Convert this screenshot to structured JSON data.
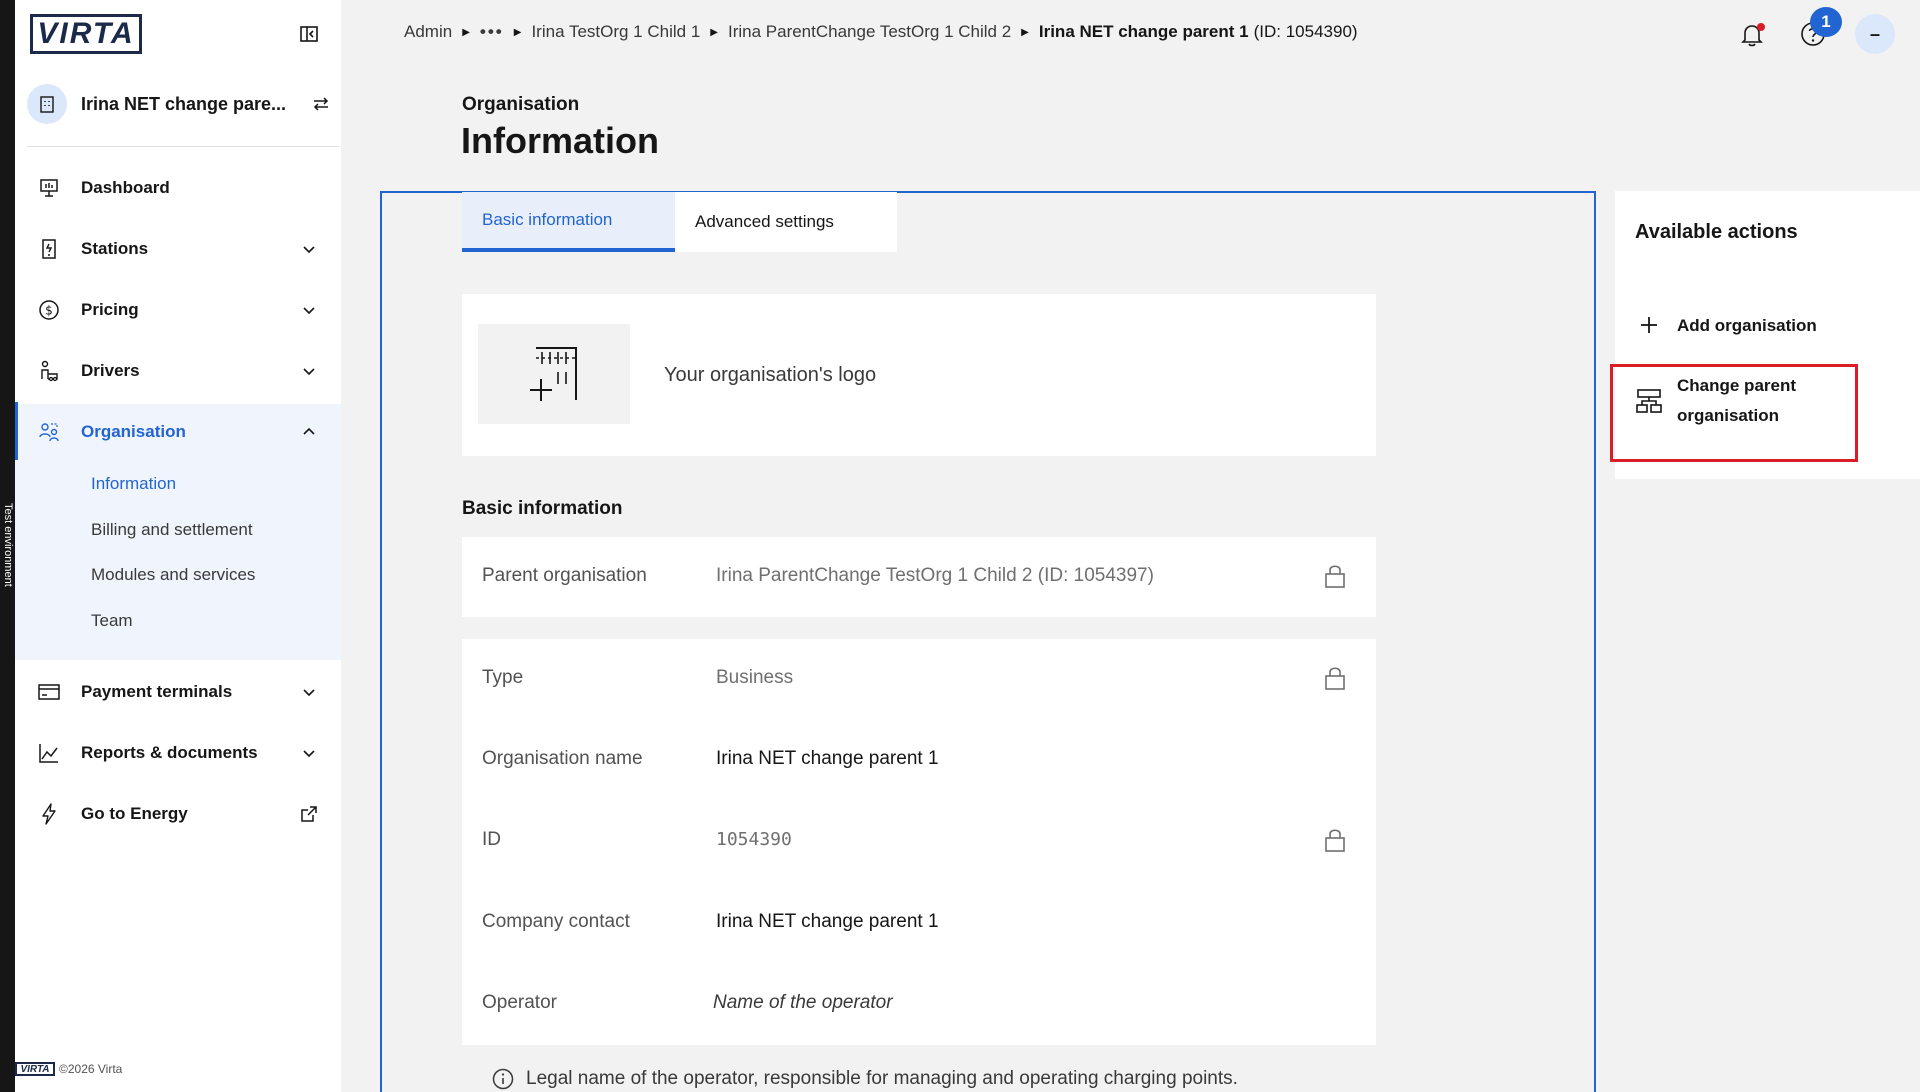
{
  "env": {
    "label": "Test environment"
  },
  "brand": {
    "logo_text": "VIRTA",
    "footer_logo": "VIRTA",
    "copyright": "©2026 Virta"
  },
  "org_switcher": {
    "name": "Irina NET change pare..."
  },
  "nav": {
    "dashboard": "Dashboard",
    "stations": "Stations",
    "pricing": "Pricing",
    "drivers": "Drivers",
    "organisation": "Organisation",
    "organisation_sub": [
      "Information",
      "Billing and settlement",
      "Modules and services",
      "Team"
    ],
    "payment_terminals": "Payment terminals",
    "reports": "Reports & documents",
    "energy": "Go to Energy"
  },
  "breadcrumb": {
    "items": [
      "Admin",
      "•••",
      "Irina TestOrg 1 Child 1",
      "Irina ParentChange TestOrg 1 Child 2"
    ],
    "current": "Irina NET change parent 1",
    "current_id": "(ID: 1054390)"
  },
  "topbar": {
    "help_badge": "1",
    "user_initial": "–"
  },
  "header": {
    "eyebrow": "Organisation",
    "title": "Information"
  },
  "tabs": [
    "Basic information",
    "Advanced settings"
  ],
  "logo_card": {
    "text": "Your organisation's logo"
  },
  "basic": {
    "section_title": "Basic information",
    "parent": {
      "label": "Parent organisation",
      "value": "Irina ParentChange TestOrg 1 Child 2 (ID: 1054397)"
    },
    "type": {
      "label": "Type",
      "value": "Business"
    },
    "name": {
      "label": "Organisation name",
      "value": "Irina NET change parent 1"
    },
    "id": {
      "label": "ID",
      "value": "1054390"
    },
    "contact": {
      "label": "Company contact",
      "value": "Irina NET change parent 1"
    },
    "operator": {
      "label": "Operator",
      "placeholder": "Name of the operator"
    },
    "operator_help": "Legal name of the operator, responsible for managing and operating charging points."
  },
  "actions": {
    "title": "Available actions",
    "add": "Add organisation",
    "change_parent_line1": "Change parent",
    "change_parent_line2": "organisation"
  },
  "colors": {
    "accent": "#2264d1",
    "highlight": "#da1e28",
    "env_strip": "#161616"
  }
}
